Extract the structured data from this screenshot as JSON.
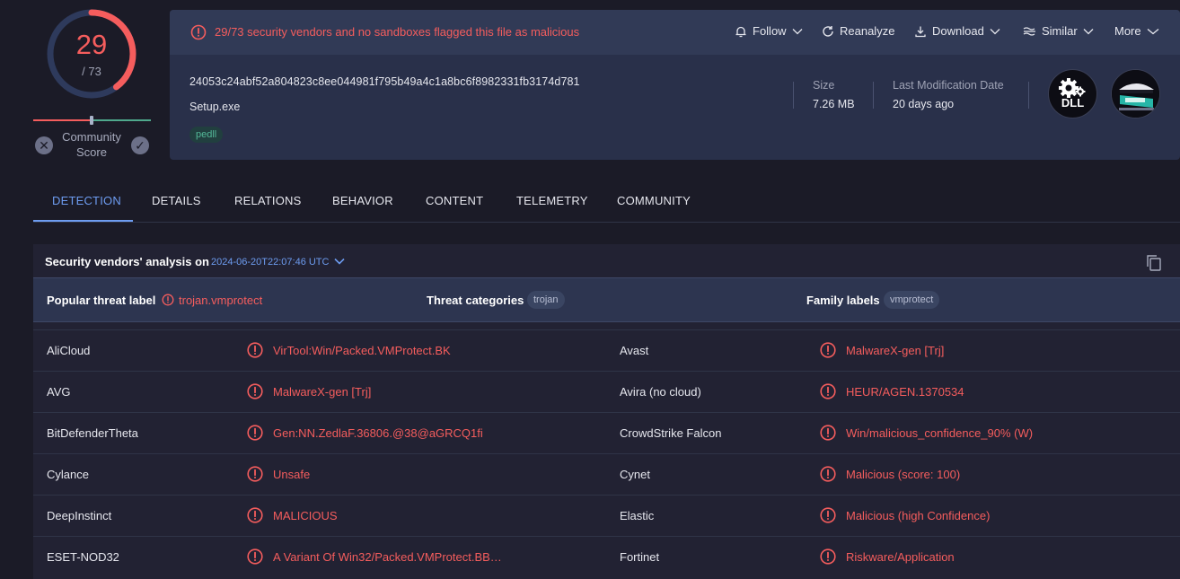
{
  "score": {
    "detections": "29",
    "total": "/ 73",
    "community_label": "Community Score",
    "community_position": 0.5
  },
  "alert": {
    "text": "29/73 security vendors and no sandboxes flagged this file as malicious"
  },
  "actions": {
    "follow": "Follow",
    "reanalyze": "Reanalyze",
    "download": "Download",
    "similar": "Similar",
    "more": "More"
  },
  "file": {
    "hash": "24053c24abf52a804823c8ee044981f795b49a4c1a8bc6f8982331fb3174d781",
    "name": "Setup.exe",
    "tag": "pedll",
    "size_label": "Size",
    "size_value": "7.26 MB",
    "modified_label": "Last Modification Date",
    "modified_value": "20 days ago",
    "type_badge": "DLL"
  },
  "tabs": [
    "DETECTION",
    "DETAILS",
    "RELATIONS",
    "BEHAVIOR",
    "CONTENT",
    "TELEMETRY",
    "COMMUNITY"
  ],
  "active_tab": "DETECTION",
  "analysis": {
    "title": "Security vendors' analysis on",
    "date": "2024-06-20T22:07:46 UTC"
  },
  "summary": {
    "popular_threat_label": "Popular threat label",
    "popular_threat_value": "trojan.vmprotect",
    "threat_categories_label": "Threat categories",
    "threat_categories_value": "trojan",
    "family_labels_label": "Family labels",
    "family_labels_value": "vmprotect"
  },
  "vendors": [
    [
      {
        "name": "AliCloud",
        "result": "VirTool:Win/Packed.VMProtect.BK"
      },
      {
        "name": "Avast",
        "result": "MalwareX-gen [Trj]"
      }
    ],
    [
      {
        "name": "AVG",
        "result": "MalwareX-gen [Trj]"
      },
      {
        "name": "Avira (no cloud)",
        "result": "HEUR/AGEN.1370534"
      }
    ],
    [
      {
        "name": "BitDefenderTheta",
        "result": "Gen:NN.ZedlaF.36806.@38@aGRCQ1fi"
      },
      {
        "name": "CrowdStrike Falcon",
        "result": "Win/malicious_confidence_90% (W)"
      }
    ],
    [
      {
        "name": "Cylance",
        "result": "Unsafe"
      },
      {
        "name": "Cynet",
        "result": "Malicious (score: 100)"
      }
    ],
    [
      {
        "name": "DeepInstinct",
        "result": "MALICIOUS"
      },
      {
        "name": "Elastic",
        "result": "Malicious (high Confidence)"
      }
    ],
    [
      {
        "name": "ESET-NOD32",
        "result": "A Variant Of Win32/Packed.VMProtect.BB…"
      },
      {
        "name": "Fortinet",
        "result": "Riskware/Application"
      }
    ]
  ],
  "colors": {
    "malicious": "#f55d5d",
    "accent": "#6d9cf0",
    "harmless": "#4fa98d"
  }
}
